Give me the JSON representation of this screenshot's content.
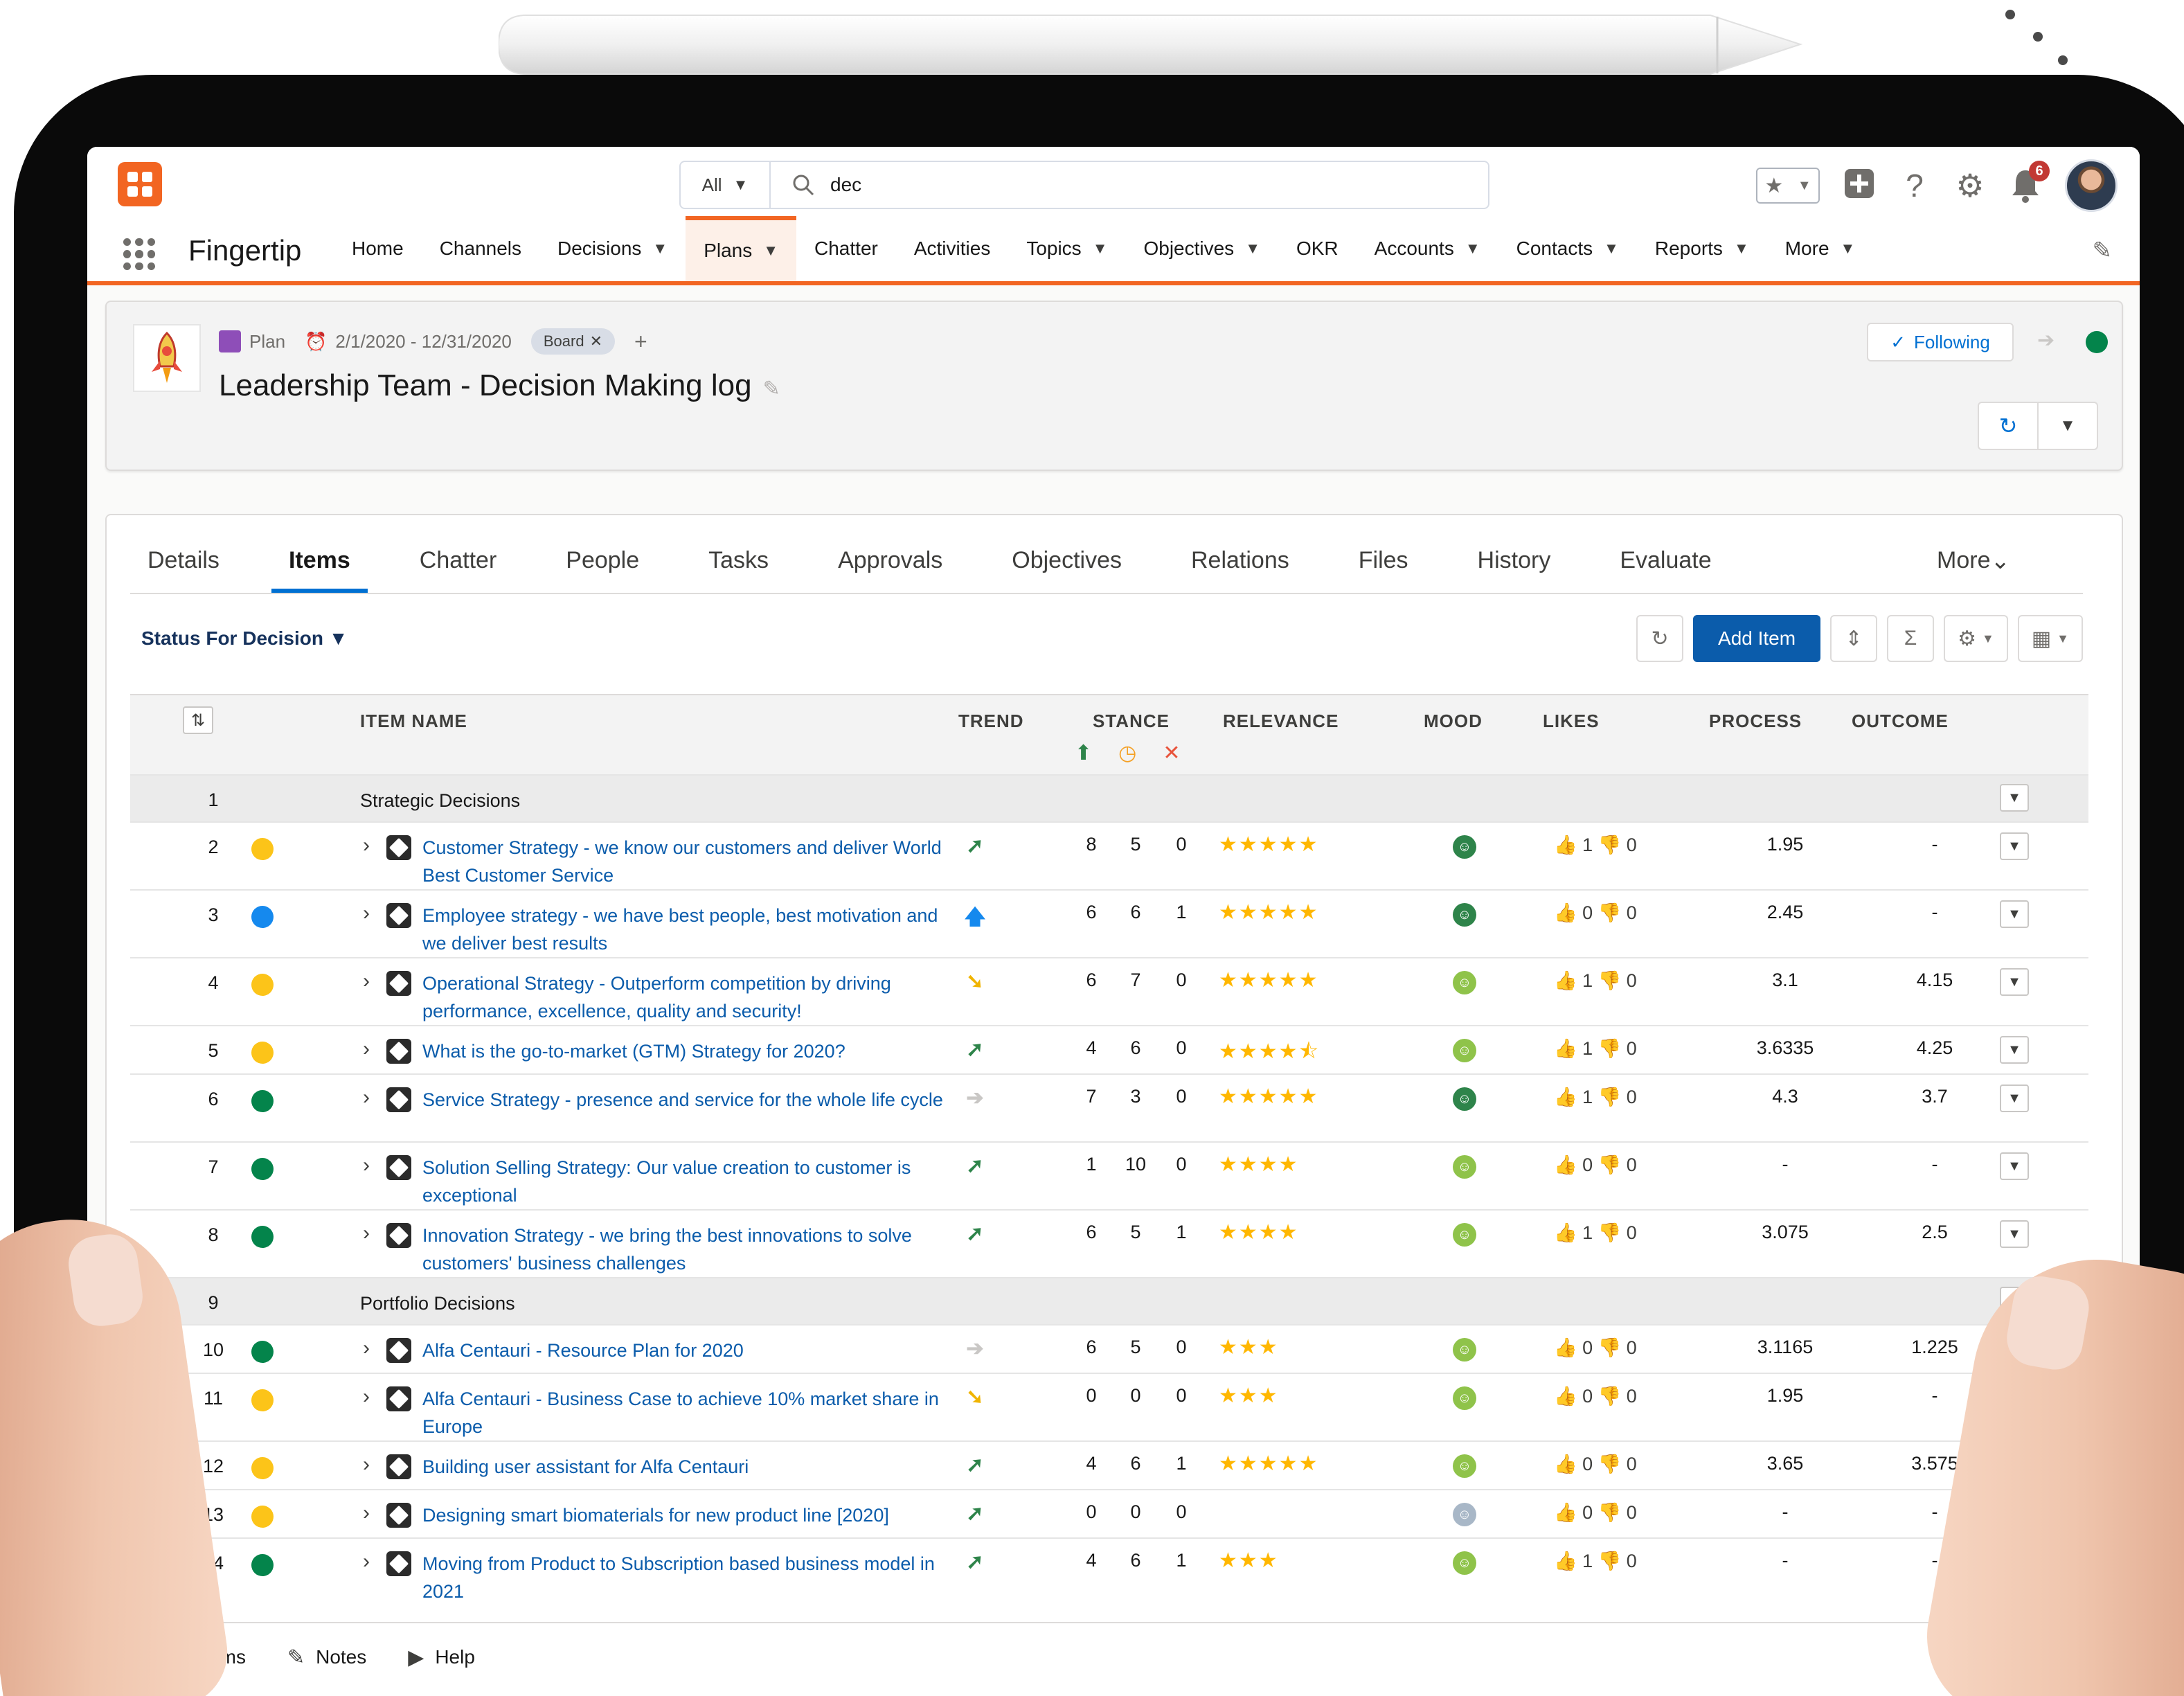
{
  "search": {
    "scope": "All",
    "query": "dec"
  },
  "header": {
    "notification_count": "6"
  },
  "nav": {
    "app_name": "Fingertip",
    "items": [
      {
        "label": "Home",
        "dropdown": false,
        "active": false
      },
      {
        "label": "Channels",
        "dropdown": false,
        "active": false
      },
      {
        "label": "Decisions",
        "dropdown": true,
        "active": false
      },
      {
        "label": "Plans",
        "dropdown": true,
        "active": true
      },
      {
        "label": "Chatter",
        "dropdown": false,
        "active": false
      },
      {
        "label": "Activities",
        "dropdown": false,
        "active": false
      },
      {
        "label": "Topics",
        "dropdown": true,
        "active": false
      },
      {
        "label": "Objectives",
        "dropdown": true,
        "active": false
      },
      {
        "label": "OKR",
        "dropdown": false,
        "active": false
      },
      {
        "label": "Accounts",
        "dropdown": true,
        "active": false
      },
      {
        "label": "Contacts",
        "dropdown": true,
        "active": false
      },
      {
        "label": "Reports",
        "dropdown": true,
        "active": false
      },
      {
        "label": "More",
        "dropdown": true,
        "active": false
      }
    ]
  },
  "record": {
    "type_label": "Plan",
    "date_range": "2/1/2020 - 12/31/2020",
    "tag": "Board",
    "title": "Leadership Team - Decision Making log",
    "following_label": "Following"
  },
  "tabs": [
    "Details",
    "Items",
    "Chatter",
    "People",
    "Tasks",
    "Approvals",
    "Objectives",
    "Relations",
    "Files",
    "History",
    "Evaluate"
  ],
  "tab_more": "More",
  "active_tab": "Items",
  "list": {
    "filter_label": "Status For Decision",
    "add_item_label": "Add Item",
    "columns": {
      "item_name": "ITEM NAME",
      "trend": "TREND",
      "stance": "STANCE",
      "relevance": "RELEVANCE",
      "mood": "MOOD",
      "likes": "LIKES",
      "process": "PROCESS",
      "outcome": "OUTCOME"
    },
    "rows": [
      {
        "kind": "group",
        "num": "1",
        "name": "Strategic Decisions"
      },
      {
        "kind": "item",
        "num": "2",
        "status": "#fcc419",
        "name": "Customer Strategy - we know our customers and deliver World Best Customer Service",
        "trend": "up-right",
        "s1": "8",
        "s2": "5",
        "s3": "0",
        "relevance": 5,
        "mood": "happy",
        "likes": "1",
        "dislikes": "0",
        "process": "1.95",
        "outcome": "-"
      },
      {
        "kind": "item",
        "num": "3",
        "status": "#1589ee",
        "name": "Employee strategy - we have best people, best motivation and we deliver best results",
        "trend": "up",
        "s1": "6",
        "s2": "6",
        "s3": "1",
        "relevance": 5,
        "mood": "happy",
        "likes": "0",
        "dislikes": "0",
        "process": "2.45",
        "outcome": "-"
      },
      {
        "kind": "item",
        "num": "4",
        "status": "#fcc419",
        "name": "Operational Strategy - Outperform competition by driving performance, excellence, quality and security!",
        "trend": "down-right",
        "s1": "6",
        "s2": "7",
        "s3": "0",
        "relevance": 5,
        "mood": "smile",
        "likes": "1",
        "dislikes": "0",
        "process": "3.1",
        "outcome": "4.15"
      },
      {
        "kind": "item",
        "num": "5",
        "status": "#fcc419",
        "name": "What is the go-to-market (GTM) Strategy for 2020?",
        "trend": "up-right",
        "s1": "4",
        "s2": "6",
        "s3": "0",
        "relevance": 4.5,
        "mood": "smile",
        "likes": "1",
        "dislikes": "0",
        "process": "3.6335",
        "outcome": "4.25"
      },
      {
        "kind": "item",
        "num": "6",
        "status": "#04844b",
        "name": "Service Strategy - presence and service for the whole life cycle",
        "trend": "right",
        "s1": "7",
        "s2": "3",
        "s3": "0",
        "relevance": 5,
        "mood": "happy",
        "likes": "1",
        "dislikes": "0",
        "process": "4.3",
        "outcome": "3.7"
      },
      {
        "kind": "item",
        "num": "7",
        "status": "#04844b",
        "name": "Solution Selling Strategy: Our value creation to customer is exceptional",
        "trend": "up-right",
        "s1": "1",
        "s2": "10",
        "s3": "0",
        "relevance": 4,
        "mood": "smile",
        "likes": "0",
        "dislikes": "0",
        "process": "-",
        "outcome": "-"
      },
      {
        "kind": "item",
        "num": "8",
        "status": "#04844b",
        "name": "Innovation Strategy - we bring the best innovations to solve customers' business challenges",
        "trend": "up-right",
        "s1": "6",
        "s2": "5",
        "s3": "1",
        "relevance": 4,
        "mood": "smile",
        "likes": "1",
        "dislikes": "0",
        "process": "3.075",
        "outcome": "2.5"
      },
      {
        "kind": "group",
        "num": "9",
        "name": "Portfolio Decisions"
      },
      {
        "kind": "item",
        "num": "10",
        "status": "#04844b",
        "name": "Alfa Centauri - Resource Plan for 2020",
        "trend": "right",
        "s1": "6",
        "s2": "5",
        "s3": "0",
        "relevance": 3,
        "mood": "smile",
        "likes": "0",
        "dislikes": "0",
        "process": "3.1165",
        "outcome": "1.225"
      },
      {
        "kind": "item",
        "num": "11",
        "status": "#fcc419",
        "name": "Alfa Centauri - Business Case to achieve 10% market share in Europe",
        "trend": "down-right",
        "s1": "0",
        "s2": "0",
        "s3": "0",
        "relevance": 3,
        "mood": "smile",
        "likes": "0",
        "dislikes": "0",
        "process": "1.95",
        "outcome": "-"
      },
      {
        "kind": "item",
        "num": "12",
        "status": "#fcc419",
        "name": "Building user assistant for Alfa Centauri",
        "trend": "up-right",
        "s1": "4",
        "s2": "6",
        "s3": "1",
        "relevance": 5,
        "mood": "smile",
        "likes": "0",
        "dislikes": "0",
        "process": "3.65",
        "outcome": "3.575"
      },
      {
        "kind": "item",
        "num": "13",
        "status": "#fcc419",
        "name": "Designing smart biomaterials for new product line [2020]",
        "trend": "up-right",
        "s1": "0",
        "s2": "0",
        "s3": "0",
        "relevance": 0,
        "mood": "neutral",
        "likes": "0",
        "dislikes": "0",
        "process": "-",
        "outcome": "-"
      },
      {
        "kind": "item",
        "num": "14",
        "status": "#04844b",
        "name": "Moving from Product to Subscription based business model in 2021",
        "trend": "up-right",
        "s1": "4",
        "s2": "6",
        "s3": "1",
        "relevance": 3,
        "mood": "smile",
        "likes": "1",
        "dislikes": "0",
        "process": "-",
        "outcome": "-"
      }
    ]
  },
  "utility": [
    {
      "icon": "recent-items-icon",
      "label": "Recent Items"
    },
    {
      "icon": "notes-icon",
      "label": "Notes"
    },
    {
      "icon": "help-video-icon",
      "label": "Help"
    }
  ],
  "colors": {
    "accent": "#f26522",
    "link": "#0b5cab",
    "primary_button": "#0b5cab",
    "star": "#ffb700",
    "mood_green": "#2e844a"
  }
}
